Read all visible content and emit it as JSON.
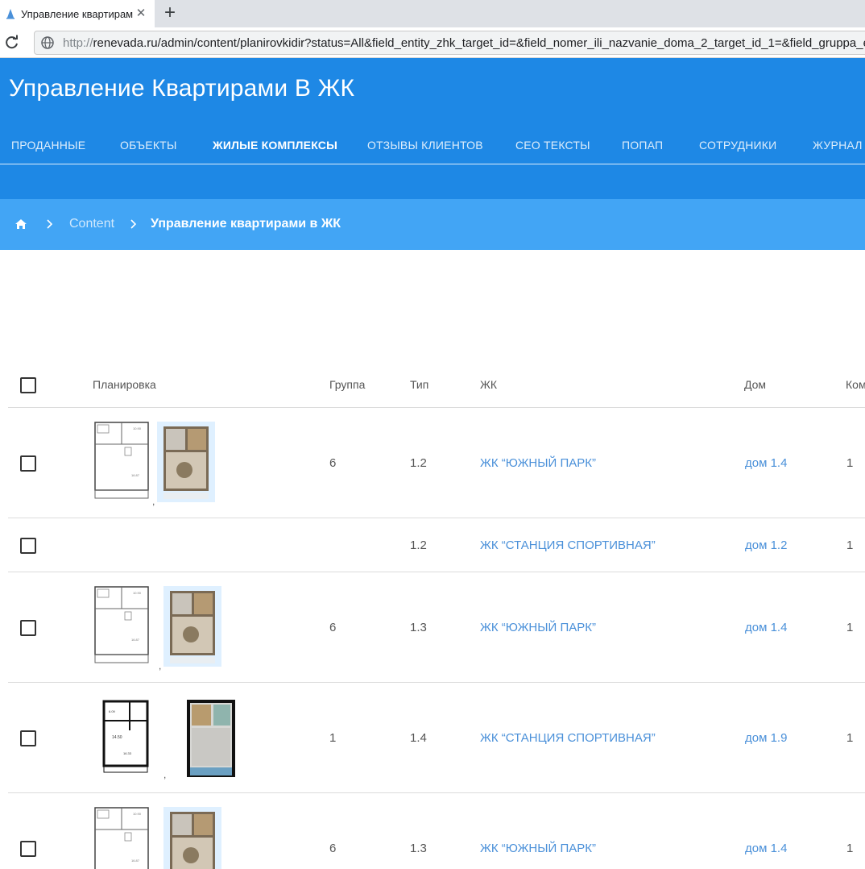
{
  "browser": {
    "tab_title": "Управление квартирами",
    "close_glyph": "✕",
    "new_tab_glyph": "+",
    "url_scheme": "http://",
    "url_rest": "renevada.ru/admin/content/planirovkidir?status=All&field_entity_zhk_target_id=&field_nomer_ili_nazvanie_doma_2_target_id_1=&field_gruppa_e"
  },
  "header": {
    "title": "Управление Квартирами В ЖК",
    "nav": [
      {
        "label": "ПРОДАННЫЕ"
      },
      {
        "label": "ОБЪЕКТЫ"
      },
      {
        "label": "ЖИЛЫЕ КОМПЛЕКСЫ"
      },
      {
        "label": "ОТЗЫВЫ КЛИЕНТОВ"
      },
      {
        "label": "СЕО ТЕКСТЫ"
      },
      {
        "label": "ПОПАП"
      },
      {
        "label": "СОТРУДНИКИ"
      },
      {
        "label": "ЖУРНАЛ"
      }
    ],
    "active_nav": "ЖИЛЫЕ КОМПЛЕКСЫ"
  },
  "breadcrumb": {
    "home_icon": "home-icon",
    "link": "Content",
    "current": "Управление квартирами в ЖК"
  },
  "table": {
    "columns": {
      "plan": "Планировка",
      "group": "Группа",
      "type": "Тип",
      "zhk": "ЖК",
      "house": "Дом",
      "extra": "Ком"
    },
    "rows": [
      {
        "has_plan": true,
        "plan_style": "light",
        "comma": ",",
        "group": "6",
        "type": "1.2",
        "zhk": "ЖК “ЮЖНЫЙ ПАРК”",
        "house": "дом 1.4",
        "extra": "1"
      },
      {
        "has_plan": false,
        "comma": "",
        "group": "",
        "type": "1.2",
        "zhk": "ЖК “СТАНЦИЯ СПОРТИВНАЯ”",
        "house": "дом 1.2",
        "extra": "1"
      },
      {
        "has_plan": true,
        "plan_style": "light",
        "comma": ",",
        "group": "6",
        "type": "1.3",
        "zhk": "ЖК “ЮЖНЫЙ ПАРК”",
        "house": "дом 1.4",
        "extra": "1"
      },
      {
        "has_plan": true,
        "plan_style": "dark",
        "comma": ",",
        "group": "1",
        "type": "1.4",
        "zhk": "ЖК “СТАНЦИЯ СПОРТИВНАЯ”",
        "house": "дом 1.9",
        "extra": "1"
      },
      {
        "has_plan": true,
        "plan_style": "light",
        "comma": ",",
        "group": "6",
        "type": "1.3",
        "zhk": "ЖК “ЮЖНЫЙ ПАРК”",
        "house": "дом 1.4",
        "extra": "1"
      }
    ]
  },
  "colors": {
    "header": "#1e88e5",
    "breadcrumb": "#42a5f5",
    "link": "#4a90d9"
  }
}
